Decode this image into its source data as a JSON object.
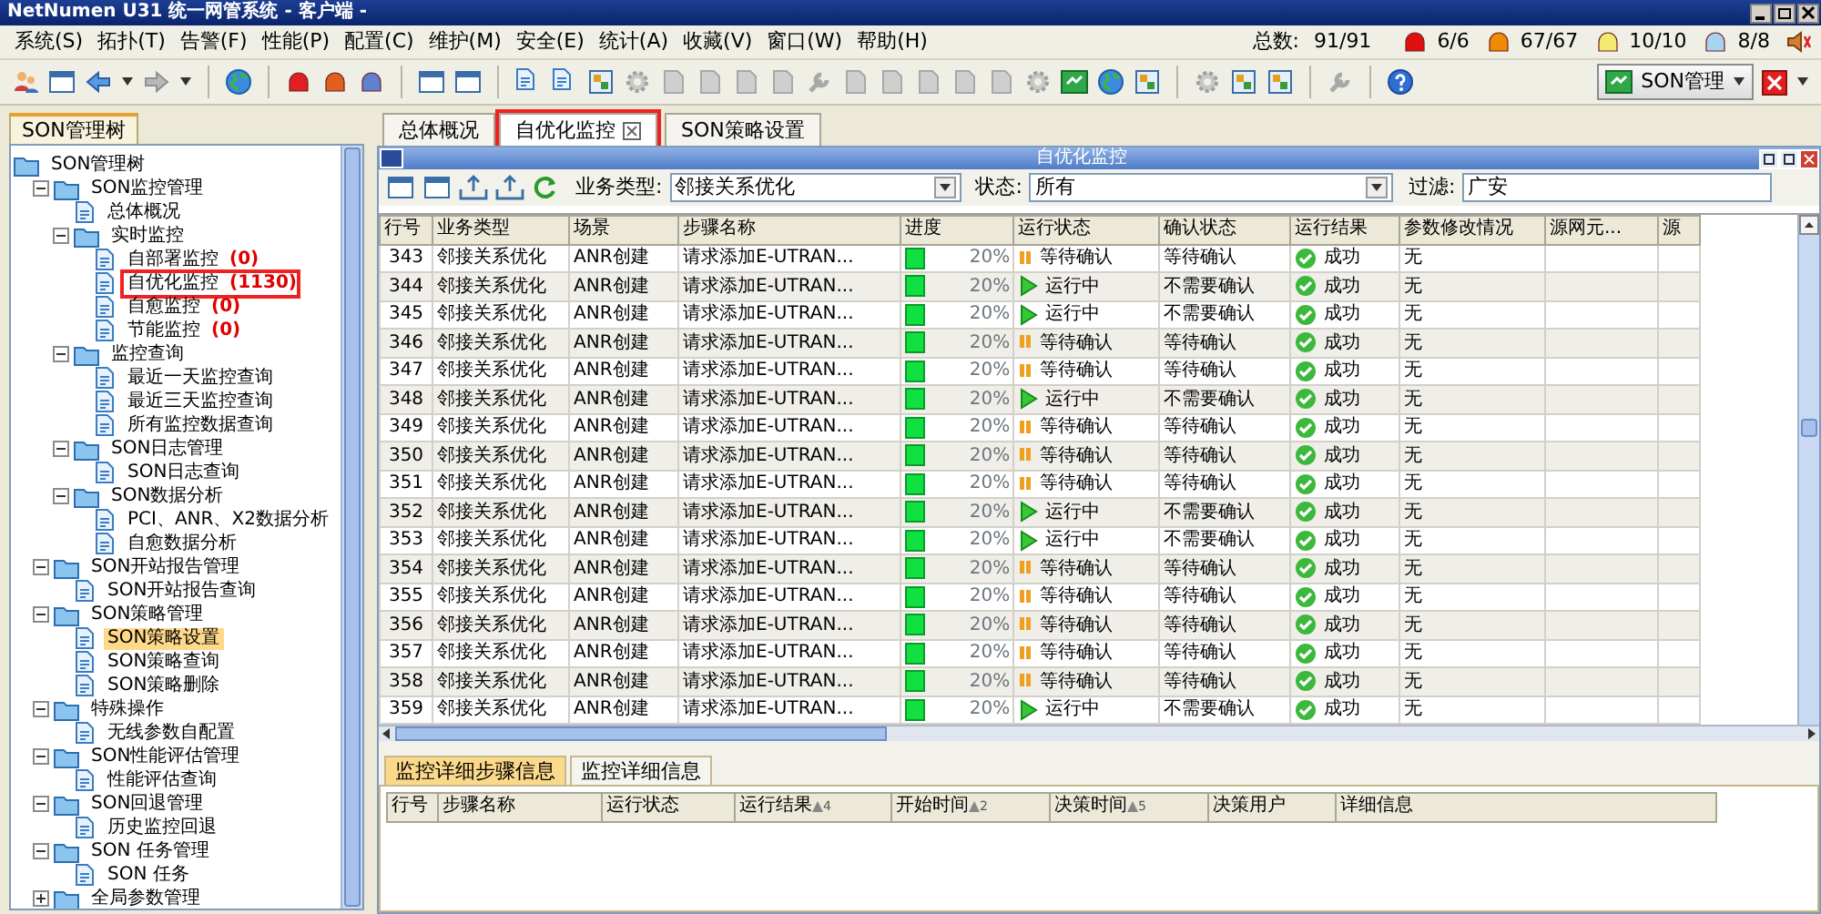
{
  "window": {
    "title": "NetNumen U31 统一网管系统 - 客户端 -"
  },
  "menu": [
    "系统(S)",
    "拓扑(T)",
    "告警(F)",
    "性能(P)",
    "配置(C)",
    "维护(M)",
    "安全(E)",
    "统计(A)",
    "收藏(V)",
    "窗口(W)",
    "帮助(H)"
  ],
  "totals": {
    "label": "总数:",
    "value": "91/91"
  },
  "alarm_counts": [
    {
      "count": "6/6",
      "color": "#e01010"
    },
    {
      "count": "67/67",
      "color": "#f08a00"
    },
    {
      "count": "10/10",
      "color": "#f2ea70"
    },
    {
      "count": "8/8",
      "color": "#a8d4f2"
    }
  ],
  "perspective_button": {
    "label": "SON管理"
  },
  "sidebar": {
    "tab": "SON管理树",
    "tree": [
      {
        "label": "SON管理树",
        "selected": false,
        "marked": false,
        "children": [
          {
            "label": "SON监控管理",
            "expanded": true,
            "selected": false,
            "marked": false,
            "children": [
              {
                "label": "总体概况",
                "selected": false,
                "marked": false
              },
              {
                "label": "实时监控",
                "expanded": true,
                "selected": false,
                "marked": false,
                "children": [
                  {
                    "label": "自部署监控",
                    "count": "(0)",
                    "selected": false,
                    "marked": false
                  },
                  {
                    "label": "自优化监控",
                    "count": "(1130)",
                    "selected": false,
                    "marked": true
                  },
                  {
                    "label": "自愈监控",
                    "count": "(0)",
                    "selected": false,
                    "marked": false
                  },
                  {
                    "label": "节能监控",
                    "count": "(0)",
                    "selected": false,
                    "marked": false
                  }
                ]
              },
              {
                "label": "监控查询",
                "expanded": true,
                "selected": false,
                "marked": false,
                "children": [
                  {
                    "label": "最近一天监控查询",
                    "selected": false,
                    "marked": false
                  },
                  {
                    "label": "最近三天监控查询",
                    "selected": false,
                    "marked": false
                  },
                  {
                    "label": "所有监控数据查询",
                    "selected": false,
                    "marked": false
                  }
                ]
              },
              {
                "label": "SON日志管理",
                "expanded": true,
                "selected": false,
                "marked": false,
                "children": [
                  {
                    "label": "SON日志查询",
                    "selected": false,
                    "marked": false
                  }
                ]
              },
              {
                "label": "SON数据分析",
                "expanded": true,
                "selected": false,
                "marked": false,
                "children": [
                  {
                    "label": "PCI、ANR、X2数据分析",
                    "selected": false,
                    "marked": false
                  },
                  {
                    "label": "自愈数据分析",
                    "selected": false,
                    "marked": false
                  }
                ]
              }
            ]
          },
          {
            "label": "SON开站报告管理",
            "expanded": true,
            "selected": false,
            "marked": false,
            "children": [
              {
                "label": "SON开站报告查询",
                "selected": false,
                "marked": false
              }
            ]
          },
          {
            "label": "SON策略管理",
            "expanded": true,
            "selected": false,
            "marked": false,
            "children": [
              {
                "label": "SON策略设置",
                "selected": true,
                "marked": false
              },
              {
                "label": "SON策略查询",
                "selected": false,
                "marked": false
              },
              {
                "label": "SON策略删除",
                "selected": false,
                "marked": false
              }
            ]
          },
          {
            "label": "特殊操作",
            "expanded": true,
            "selected": false,
            "marked": false,
            "children": [
              {
                "label": "无线参数自配置",
                "selected": false,
                "marked": false
              }
            ]
          },
          {
            "label": "SON性能评估管理",
            "expanded": true,
            "selected": false,
            "marked": false,
            "children": [
              {
                "label": "性能评估查询",
                "selected": false,
                "marked": false
              }
            ]
          },
          {
            "label": "SON回退管理",
            "expanded": true,
            "selected": false,
            "marked": false,
            "children": [
              {
                "label": "历史监控回退",
                "selected": false,
                "marked": false
              }
            ]
          },
          {
            "label": "SON 任务管理",
            "expanded": true,
            "selected": false,
            "marked": false,
            "children": [
              {
                "label": "SON 任务",
                "selected": false,
                "marked": false
              }
            ]
          },
          {
            "label": "全局参数管理",
            "expanded": false,
            "selected": false,
            "marked": false
          }
        ]
      }
    ]
  },
  "tabs": [
    {
      "label": "总体概况",
      "selected": false,
      "closable": false,
      "marked": false
    },
    {
      "label": "自优化监控",
      "selected": true,
      "closable": true,
      "marked": true
    },
    {
      "label": "SON策略设置",
      "selected": false,
      "closable": false,
      "marked": false
    }
  ],
  "panel": {
    "title": "自优化监控",
    "filters": [
      {
        "label": "业务类型:",
        "kind": "select",
        "value": "邻接关系优化"
      },
      {
        "label": "状态:",
        "kind": "select",
        "value": "所有"
      },
      {
        "label": "过滤:",
        "kind": "input",
        "value": "广安"
      }
    ]
  },
  "table": {
    "columns": [
      "行号",
      "业务类型",
      "场景",
      "步骤名称",
      "进度",
      "运行状态",
      "确认状态",
      "运行结果",
      "参数修改情况",
      "源网元...",
      "源"
    ],
    "rows": [
      {
        "no": "343",
        "business": "邻接关系优化",
        "scene": "ANR创建",
        "step": "请求添加E-UTRAN...",
        "level": 0.2,
        "progress": "20%",
        "kind": "waiting",
        "run_status": "等待确认",
        "confirm": "等待确认",
        "result": "成功",
        "param": "无"
      },
      {
        "no": "344",
        "business": "邻接关系优化",
        "scene": "ANR创建",
        "step": "请求添加E-UTRAN...",
        "level": 0.2,
        "progress": "20%",
        "kind": "running",
        "run_status": "运行中",
        "confirm": "不需要确认",
        "result": "成功",
        "param": "无"
      },
      {
        "no": "345",
        "business": "邻接关系优化",
        "scene": "ANR创建",
        "step": "请求添加E-UTRAN...",
        "level": 0.2,
        "progress": "20%",
        "kind": "running",
        "run_status": "运行中",
        "confirm": "不需要确认",
        "result": "成功",
        "param": "无"
      },
      {
        "no": "346",
        "business": "邻接关系优化",
        "scene": "ANR创建",
        "step": "请求添加E-UTRAN...",
        "level": 0.2,
        "progress": "20%",
        "kind": "waiting",
        "run_status": "等待确认",
        "confirm": "等待确认",
        "result": "成功",
        "param": "无"
      },
      {
        "no": "347",
        "business": "邻接关系优化",
        "scene": "ANR创建",
        "step": "请求添加E-UTRAN...",
        "level": 0.2,
        "progress": "20%",
        "kind": "waiting",
        "run_status": "等待确认",
        "confirm": "等待确认",
        "result": "成功",
        "param": "无"
      },
      {
        "no": "348",
        "business": "邻接关系优化",
        "scene": "ANR创建",
        "step": "请求添加E-UTRAN...",
        "level": 0.2,
        "progress": "20%",
        "kind": "running",
        "run_status": "运行中",
        "confirm": "不需要确认",
        "result": "成功",
        "param": "无"
      },
      {
        "no": "349",
        "business": "邻接关系优化",
        "scene": "ANR创建",
        "step": "请求添加E-UTRAN...",
        "level": 0.2,
        "progress": "20%",
        "kind": "waiting",
        "run_status": "等待确认",
        "confirm": "等待确认",
        "result": "成功",
        "param": "无"
      },
      {
        "no": "350",
        "business": "邻接关系优化",
        "scene": "ANR创建",
        "step": "请求添加E-UTRAN...",
        "level": 0.2,
        "progress": "20%",
        "kind": "waiting",
        "run_status": "等待确认",
        "confirm": "等待确认",
        "result": "成功",
        "param": "无"
      },
      {
        "no": "351",
        "business": "邻接关系优化",
        "scene": "ANR创建",
        "step": "请求添加E-UTRAN...",
        "level": 0.2,
        "progress": "20%",
        "kind": "waiting",
        "run_status": "等待确认",
        "confirm": "等待确认",
        "result": "成功",
        "param": "无"
      },
      {
        "no": "352",
        "business": "邻接关系优化",
        "scene": "ANR创建",
        "step": "请求添加E-UTRAN...",
        "level": 0.2,
        "progress": "20%",
        "kind": "running",
        "run_status": "运行中",
        "confirm": "不需要确认",
        "result": "成功",
        "param": "无"
      },
      {
        "no": "353",
        "business": "邻接关系优化",
        "scene": "ANR创建",
        "step": "请求添加E-UTRAN...",
        "level": 0.2,
        "progress": "20%",
        "kind": "running",
        "run_status": "运行中",
        "confirm": "不需要确认",
        "result": "成功",
        "param": "无"
      },
      {
        "no": "354",
        "business": "邻接关系优化",
        "scene": "ANR创建",
        "step": "请求添加E-UTRAN...",
        "level": 0.2,
        "progress": "20%",
        "kind": "waiting",
        "run_status": "等待确认",
        "confirm": "等待确认",
        "result": "成功",
        "param": "无"
      },
      {
        "no": "355",
        "business": "邻接关系优化",
        "scene": "ANR创建",
        "step": "请求添加E-UTRAN...",
        "level": 0.2,
        "progress": "20%",
        "kind": "waiting",
        "run_status": "等待确认",
        "confirm": "等待确认",
        "result": "成功",
        "param": "无"
      },
      {
        "no": "356",
        "business": "邻接关系优化",
        "scene": "ANR创建",
        "step": "请求添加E-UTRAN...",
        "level": 0.2,
        "progress": "20%",
        "kind": "waiting",
        "run_status": "等待确认",
        "confirm": "等待确认",
        "result": "成功",
        "param": "无"
      },
      {
        "no": "357",
        "business": "邻接关系优化",
        "scene": "ANR创建",
        "step": "请求添加E-UTRAN...",
        "level": 0.2,
        "progress": "20%",
        "kind": "waiting",
        "run_status": "等待确认",
        "confirm": "等待确认",
        "result": "成功",
        "param": "无"
      },
      {
        "no": "358",
        "business": "邻接关系优化",
        "scene": "ANR创建",
        "step": "请求添加E-UTRAN...",
        "level": 0.2,
        "progress": "20%",
        "kind": "waiting",
        "run_status": "等待确认",
        "confirm": "等待确认",
        "result": "成功",
        "param": "无"
      },
      {
        "no": "359",
        "business": "邻接关系优化",
        "scene": "ANR创建",
        "step": "请求添加E-UTRAN...",
        "level": 0.2,
        "progress": "20%",
        "kind": "running",
        "run_status": "运行中",
        "confirm": "不需要确认",
        "result": "成功",
        "param": "无"
      }
    ]
  },
  "detail_tabs": [
    {
      "label": "监控详细步骤信息",
      "selected": true
    },
    {
      "label": "监控详细信息",
      "selected": false
    }
  ],
  "detail_table": {
    "columns": [
      {
        "label": "行号"
      },
      {
        "label": "步骤名称"
      },
      {
        "label": "运行状态"
      },
      {
        "label": "运行结果",
        "sort": "4"
      },
      {
        "label": "开始时间",
        "sort": "2"
      },
      {
        "label": "决策时间",
        "sort": "5"
      },
      {
        "label": "决策用户"
      },
      {
        "label": "详细信息"
      }
    ]
  }
}
